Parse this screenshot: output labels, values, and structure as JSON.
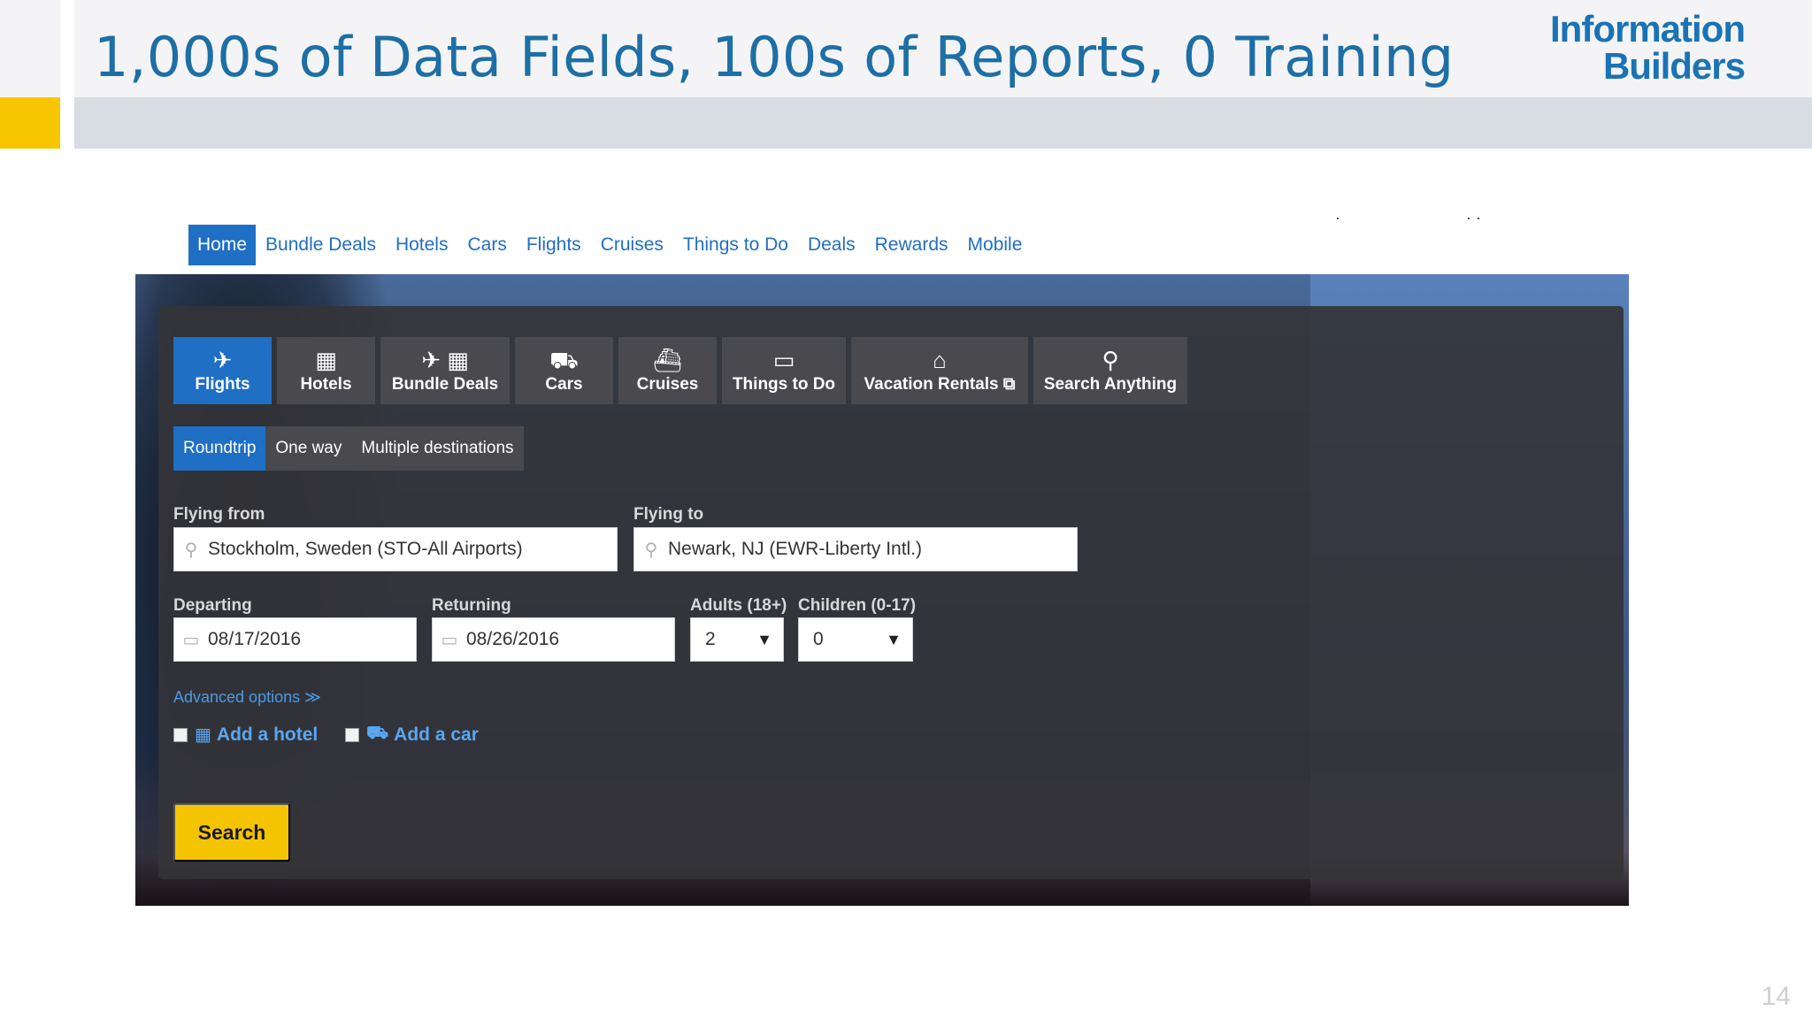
{
  "slide": {
    "title": "1,000s of Data Fields, 100s of Reports, 0 Training",
    "brand_line1": "Information",
    "brand_line2": "Builders",
    "page_number": "14"
  },
  "topnav": {
    "items": [
      "Home",
      "Bundle Deals",
      "Hotels",
      "Cars",
      "Flights",
      "Cruises",
      "Things to Do",
      "Deals",
      "Rewards",
      "Mobile"
    ],
    "active": "Home"
  },
  "search_tabs": [
    {
      "label": "Flights",
      "icon": "airplane-icon",
      "glyph": "✈"
    },
    {
      "label": "Hotels",
      "icon": "hotel-icon",
      "glyph": "▦"
    },
    {
      "label": "Bundle Deals",
      "icon": "bundle-icon",
      "glyph": "✈ ▦"
    },
    {
      "label": "Cars",
      "icon": "car-icon",
      "glyph": "⛟"
    },
    {
      "label": "Cruises",
      "icon": "cruise-icon",
      "glyph": "⛴"
    },
    {
      "label": "Things to Do",
      "icon": "ticket-icon",
      "glyph": "▭"
    },
    {
      "label": "Vacation Rentals ⧉",
      "icon": "house-icon",
      "glyph": "⌂"
    },
    {
      "label": "Search Anything",
      "icon": "search-icon",
      "glyph": "⚲"
    }
  ],
  "trip_types": [
    "Roundtrip",
    "One way",
    "Multiple destinations"
  ],
  "form": {
    "flying_from_label": "Flying from",
    "flying_from_value": "Stockholm, Sweden (STO-All Airports)",
    "flying_to_label": "Flying to",
    "flying_to_value": "Newark, NJ (EWR-Liberty Intl.)",
    "departing_label": "Departing",
    "departing_value": "08/17/2016",
    "returning_label": "Returning",
    "returning_value": "08/26/2016",
    "adults_label": "Adults (18+)",
    "adults_value": "2",
    "children_label": "Children (0-17)",
    "children_value": "0",
    "advanced_options": "Advanced options ≫",
    "add_hotel": "Add a hotel",
    "add_car": "Add a car",
    "search_button": "Search"
  },
  "colors": {
    "accent_blue": "#1f6fc4",
    "title_blue": "#1d6fa5",
    "search_yellow": "#f5c400",
    "slide_accent_yellow": "#f7c600"
  }
}
